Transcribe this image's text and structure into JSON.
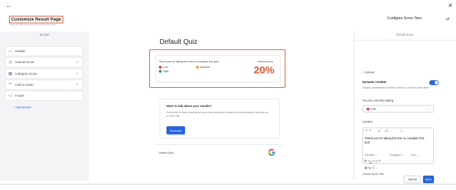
{
  "header": {
    "title": "Customize Result Page",
    "subtitle": "Also will see this when they finish the quiz",
    "configure_button": "Configure Score Tiers"
  },
  "left_panel": {
    "heading": "Section",
    "items": [
      {
        "label": "Header",
        "icon": "header-icon"
      },
      {
        "label": "Overall Score",
        "icon": "score-icon"
      },
      {
        "label": "Category Score",
        "icon": "category-icon"
      },
      {
        "label": "Call to Action",
        "icon": "cta-icon"
      },
      {
        "label": "Footer",
        "icon": "footer-icon"
      }
    ],
    "add_section": "+ Add Section"
  },
  "preview": {
    "quiz_title": "Default Quiz",
    "result_message": "Thank you for taking the time to complete this quiz.",
    "legend": [
      {
        "label": "Low",
        "color": "#e23b3b"
      },
      {
        "label": "Medium",
        "color": "#f59e0b"
      },
      {
        "label": "High",
        "color": "#22a55b"
      }
    ],
    "overall_score_label": "Overall score",
    "overall_score_value": "20%",
    "cta": {
      "title": "Want to talk about your results?",
      "body": "If you'd like to learn more about your score and what it means for your business, hop jump on a zoom call.",
      "button": "Subscribe"
    },
    "footer_name": "Default Quiz"
  },
  "right_panel": {
    "heading": "Overall Score",
    "content_section": "Content",
    "dynamic_label": "Dynamic Content",
    "dynamic_desc": "Display customized content based on overall score tiers",
    "editing_label": "You are currently editing",
    "editing_value": "Low",
    "content_label": "Content",
    "toolbar_size": "13",
    "editor_text": "Thank you for taking the time to complete this quiz.",
    "font_family": "Verdana",
    "paragraph": "Paragraph",
    "blue": "blue",
    "title_label": "Overall Score Title"
  },
  "footer": {
    "cancel": "Cancel",
    "save": "Save"
  },
  "colors": {
    "accent": "#2563eb",
    "highlight": "#e2552b"
  }
}
